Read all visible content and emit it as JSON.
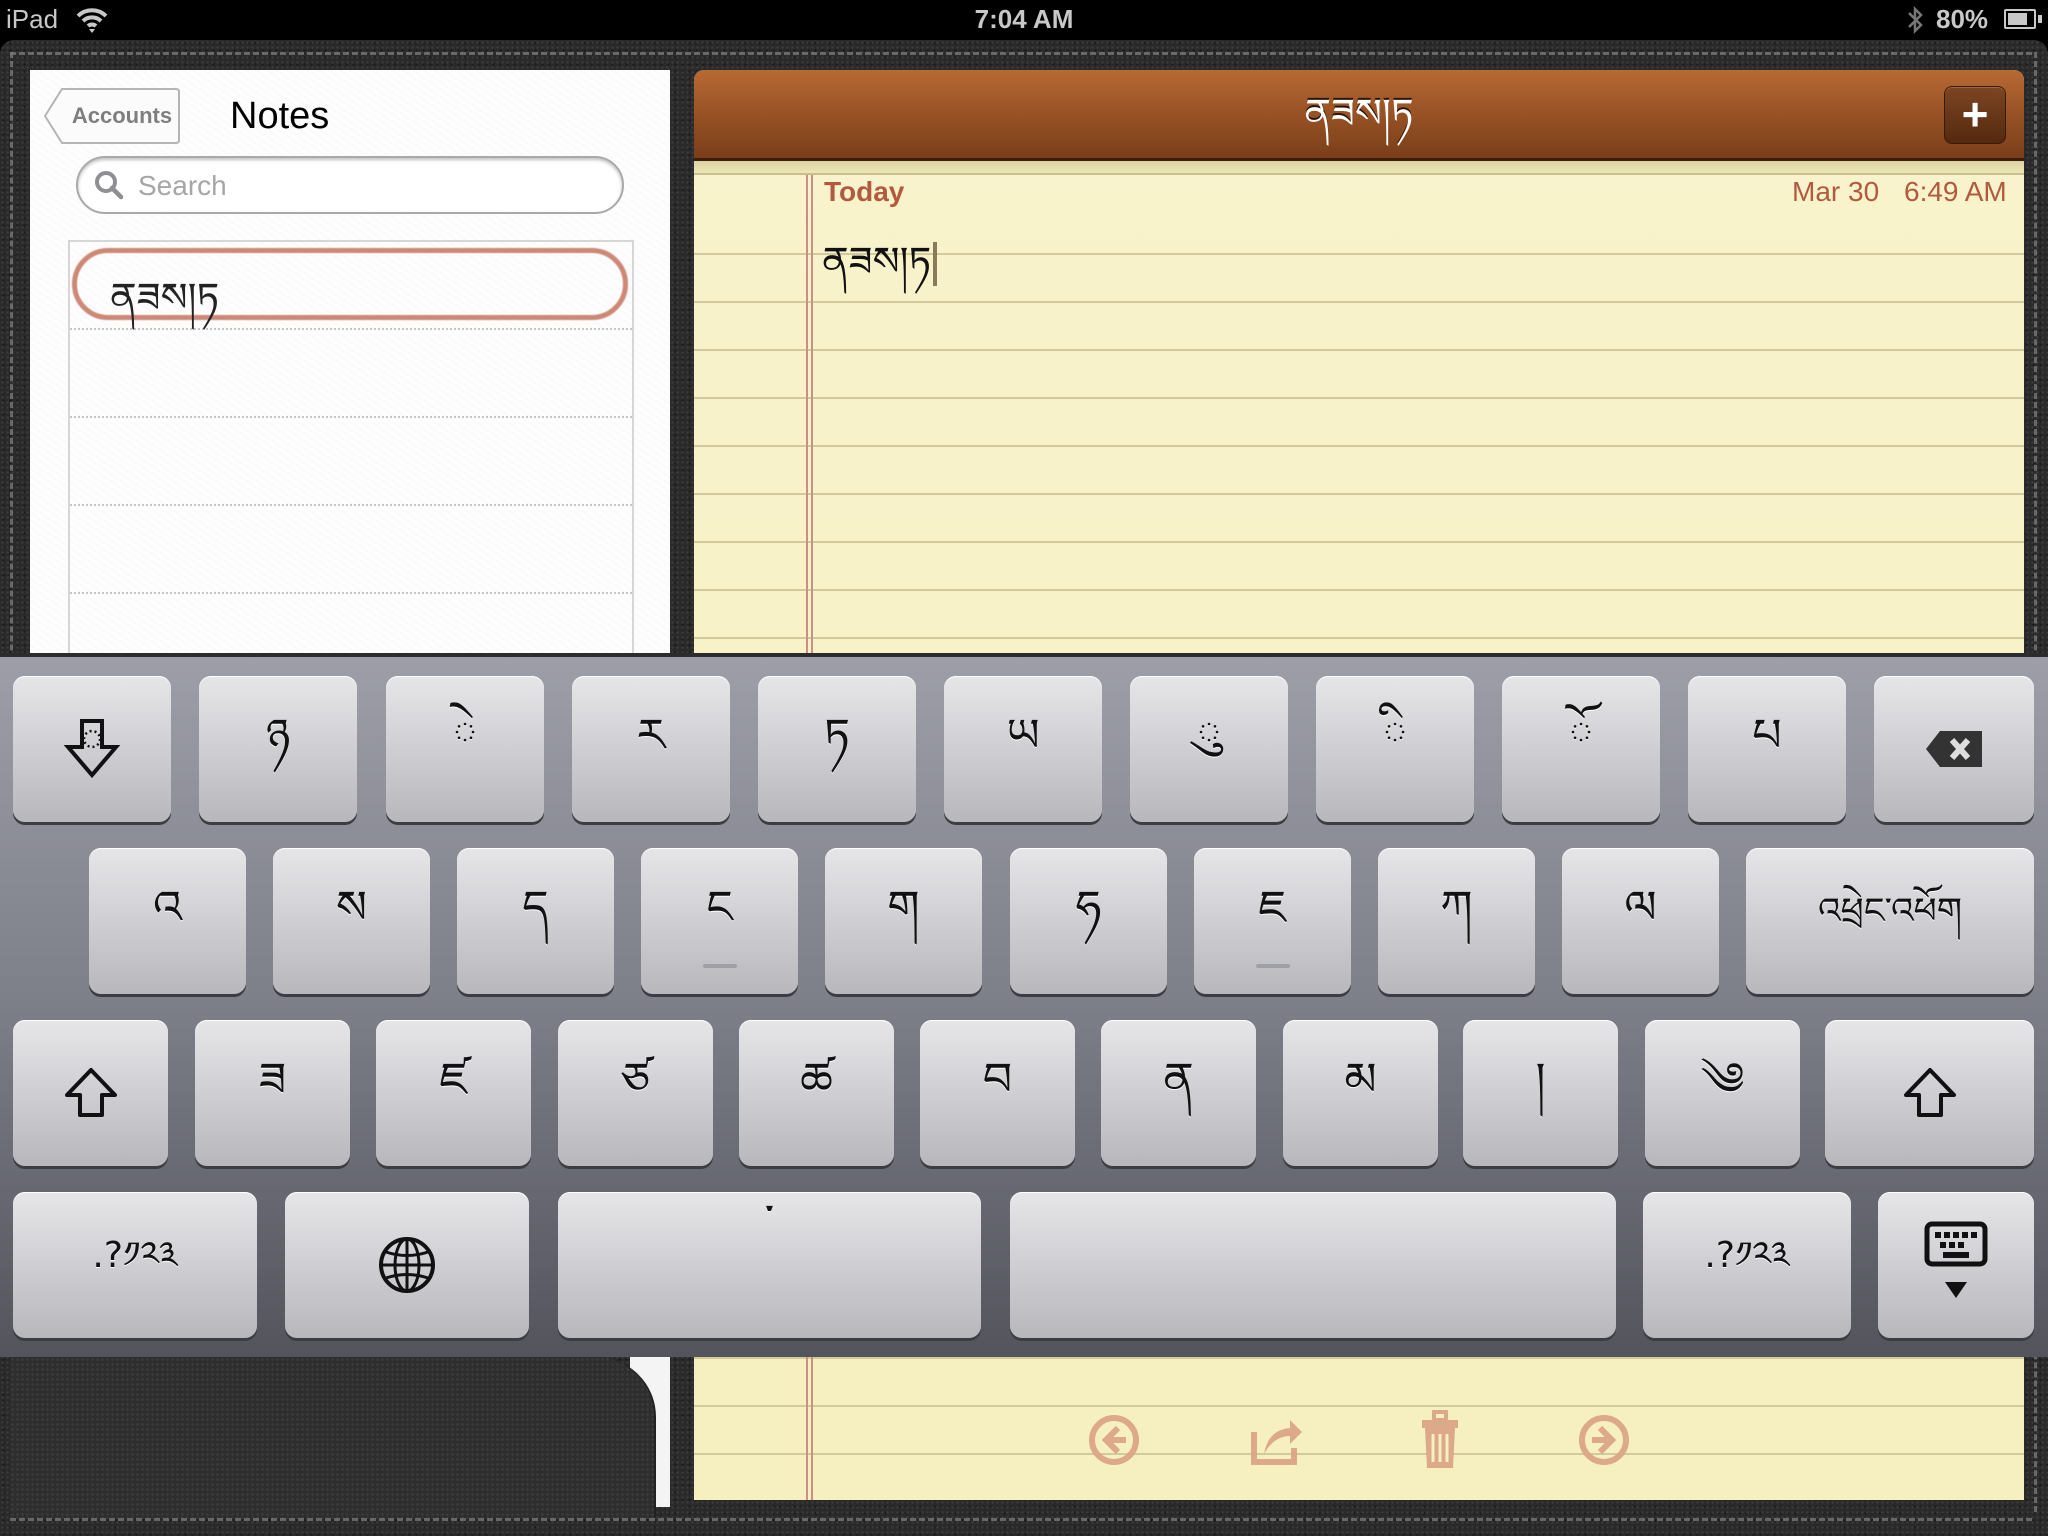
{
  "status_bar": {
    "device": "iPad",
    "wifi_icon": "wifi-icon",
    "time": "7:04 AM",
    "bluetooth_icon": "bluetooth-icon",
    "battery_percent": "80%",
    "battery_level": 0.8
  },
  "sidebar": {
    "back_button": "Accounts",
    "title": "Notes",
    "search": {
      "placeholder": "Search",
      "value": ""
    },
    "notes": [
      {
        "title": "ནཟས།ཏ",
        "selected": true
      }
    ]
  },
  "note": {
    "title": "ནཟས།ཏ",
    "add_button": "+",
    "day_label": "Today",
    "date": "Mar 30",
    "time": "6:49 AM",
    "body": "ནཟས།ཏ",
    "toolbar": [
      {
        "name": "previous-note",
        "icon": "arrow-left-circle-icon"
      },
      {
        "name": "share",
        "icon": "share-icon"
      },
      {
        "name": "delete",
        "icon": "trash-icon"
      },
      {
        "name": "next-note",
        "icon": "arrow-right-circle-icon"
      }
    ]
  },
  "keyboard": {
    "language": "Tibetan",
    "row1": [
      {
        "label": "",
        "name": "subjoin-key",
        "icon": "subjoin-arrow-icon"
      },
      {
        "label": "ཉ"
      },
      {
        "label": "◌ེ"
      },
      {
        "label": "ར"
      },
      {
        "label": "ཏ"
      },
      {
        "label": "ཡ"
      },
      {
        "label": "◌ུ"
      },
      {
        "label": "◌ི"
      },
      {
        "label": "◌ོ"
      },
      {
        "label": "པ"
      },
      {
        "label": "",
        "name": "delete-key",
        "icon": "backspace-icon"
      }
    ],
    "row2": [
      {
        "label": "འ"
      },
      {
        "label": "ས"
      },
      {
        "label": "ད"
      },
      {
        "label": "ང",
        "home_bar": true
      },
      {
        "label": "ག"
      },
      {
        "label": "ཧ"
      },
      {
        "label": "ཇ",
        "home_bar": true
      },
      {
        "label": "ཀ"
      },
      {
        "label": "ལ"
      },
      {
        "label": "འཕྲེང་འཕོག",
        "name": "return-key"
      }
    ],
    "row3": [
      {
        "label": "",
        "name": "shift-key-left",
        "icon": "shift-icon"
      },
      {
        "label": "ཟ"
      },
      {
        "label": "ཛ"
      },
      {
        "label": "ཙ"
      },
      {
        "label": "ཚ"
      },
      {
        "label": "བ"
      },
      {
        "label": "ན"
      },
      {
        "label": "མ"
      },
      {
        "label": "།"
      },
      {
        "label": "༄"
      },
      {
        "label": "",
        "name": "shift-key-right",
        "icon": "shift-icon"
      }
    ],
    "row4": [
      {
        "label": ".?༡༢༣",
        "name": "numbers-key-left"
      },
      {
        "label": "",
        "name": "globe-key",
        "icon": "globe-icon"
      },
      {
        "label": "་",
        "name": "tsheg-key"
      },
      {
        "label": "",
        "name": "space-key"
      },
      {
        "label": ".?༡༢༣",
        "name": "numbers-key-right"
      },
      {
        "label": "",
        "name": "hide-keyboard-key",
        "icon": "keyboard-hide-icon"
      }
    ]
  }
}
